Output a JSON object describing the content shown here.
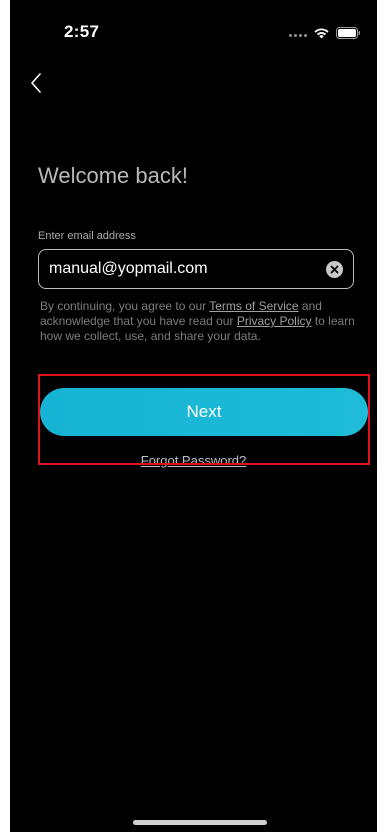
{
  "status_bar": {
    "time": "2:57"
  },
  "icons": {
    "back": "chevron-left-icon",
    "clear": "clear-x-circle-icon",
    "wifi": "wifi-icon",
    "battery": "battery-icon",
    "signal": "signal-dots-icon"
  },
  "login": {
    "title": "Welcome back!",
    "email_label": "Enter email address",
    "email_value": "manual@yopmail.com",
    "legal": {
      "prefix": "By continuing, you agree to our ",
      "terms_link": "Terms of Service",
      "middle": " and acknowledge that you have read our ",
      "privacy_link": "Privacy Policy",
      "suffix": " to learn how we collect, use, and share your data."
    },
    "next_label": "Next",
    "forgot_label": "Forgot Password?"
  },
  "colors": {
    "background": "#000000",
    "accent": "#1ab7d6",
    "highlight": "#e0121b"
  }
}
